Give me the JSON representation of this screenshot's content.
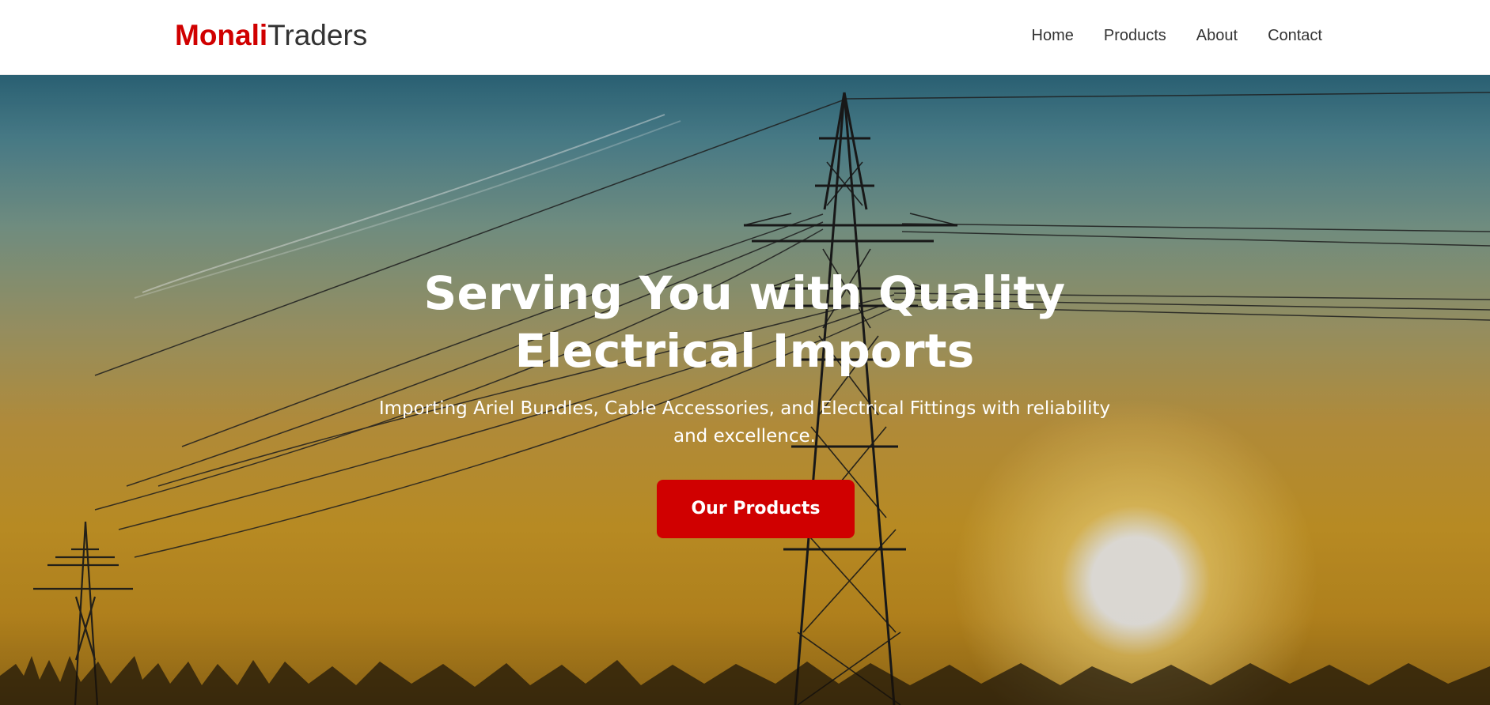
{
  "header": {
    "brand": {
      "primary": "Monali",
      "secondary": "Traders"
    },
    "nav": [
      {
        "label": "Home"
      },
      {
        "label": "Products"
      },
      {
        "label": "About"
      },
      {
        "label": "Contact"
      }
    ]
  },
  "hero": {
    "title_line_1": "Serving You with Quality",
    "title_line_2": "Electrical Imports",
    "subtitle_line_1": "Importing Ariel Bundles, Cable Accessories, and Electrical Fittings with reliability",
    "subtitle_line_2": "and excellence.",
    "cta_label": "Our Products"
  },
  "colors": {
    "brand_red": "#d00000",
    "nav_text": "#333333",
    "hero_text": "#ffffff"
  }
}
